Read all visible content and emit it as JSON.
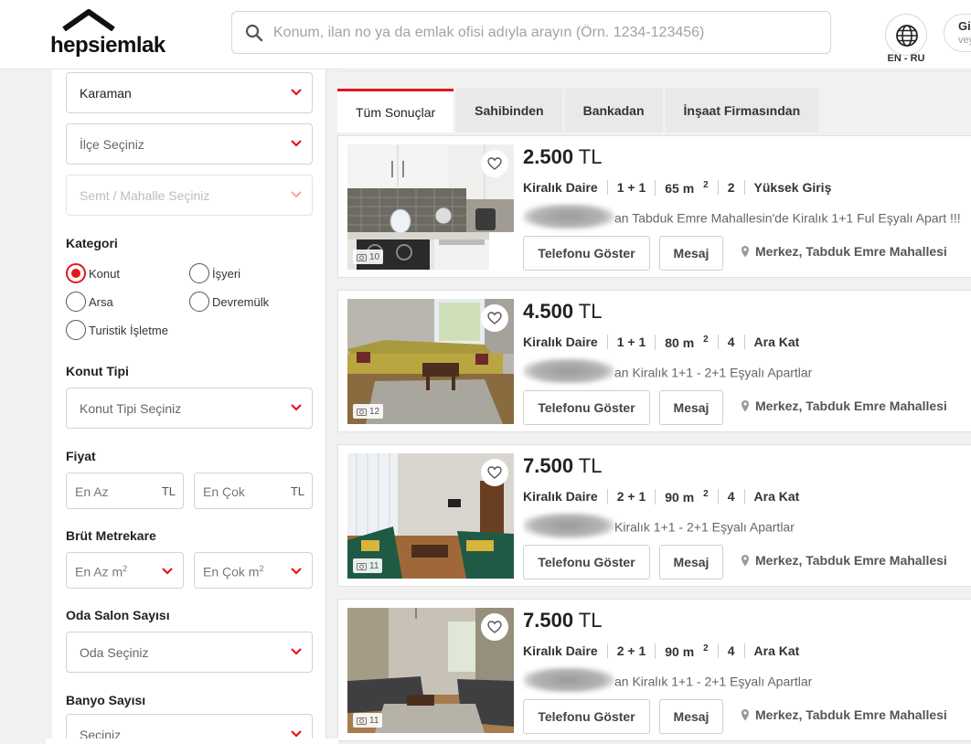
{
  "header": {
    "logo_text": "hepsiemlak",
    "search_placeholder": "Konum, ilan no ya da emlak ofisi adıyla arayın (Örn. 1234-123456)",
    "lang_label": "EN - RU",
    "login_line1": "Giriş",
    "login_line2": "veya"
  },
  "sidebar": {
    "city": "Karaman",
    "district": "İlçe Seçiniz",
    "neighborhood": "Semt / Mahalle Seçiniz",
    "category_title": "Kategori",
    "categories": [
      {
        "label": "Konut",
        "selected": true
      },
      {
        "label": "İşyeri",
        "selected": false
      },
      {
        "label": "Arsa",
        "selected": false
      },
      {
        "label": "Devremülk",
        "selected": false
      },
      {
        "label": "Turistik İşletme",
        "selected": false
      }
    ],
    "type_title": "Konut Tipi",
    "type_select": "Konut Tipi Seçiniz",
    "price_title": "Fiyat",
    "price_min": "En Az",
    "price_max": "En Çok",
    "price_unit": "TL",
    "area_title": "Brüt Metrekare",
    "area_min": "En Az m",
    "area_max": "En Çok m",
    "area_sup": "2",
    "rooms_title": "Oda Salon Sayısı",
    "rooms_select": "Oda Seçiniz",
    "bath_title": "Banyo Sayısı",
    "bath_select": "Seçiniz"
  },
  "tabs": [
    "Tüm Sonuçlar",
    "Sahibinden",
    "Bankadan",
    "İnşaat Firmasından"
  ],
  "listings": [
    {
      "price_num": "2.500",
      "currency": "TL",
      "type": "Kiralık Daire",
      "rooms": "1 + 1",
      "area": "65 m",
      "area_sup": "2",
      "floor_count": "2",
      "floor": "Yüksek Giriş",
      "title": "an Tabduk Emre Mahallesin'de Kiralık 1+1 Ful Eşyalı Apart !!!",
      "photo_count": "10",
      "location": "Merkez, Tabduk Emre Mahallesi"
    },
    {
      "price_num": "4.500",
      "currency": "TL",
      "type": "Kiralık Daire",
      "rooms": "1 + 1",
      "area": "80 m",
      "area_sup": "2",
      "floor_count": "4",
      "floor": "Ara Kat",
      "title": "an Kiralık 1+1 - 2+1 Eşyalı Apartlar",
      "photo_count": "12",
      "location": "Merkez, Tabduk Emre Mahallesi"
    },
    {
      "price_num": "7.500",
      "currency": "TL",
      "type": "Kiralık Daire",
      "rooms": "2 + 1",
      "area": "90 m",
      "area_sup": "2",
      "floor_count": "4",
      "floor": "Ara Kat",
      "title": "Kiralık 1+1 - 2+1 Eşyalı Apartlar",
      "photo_count": "11",
      "location": "Merkez, Tabduk Emre Mahallesi"
    },
    {
      "price_num": "7.500",
      "currency": "TL",
      "type": "Kiralık Daire",
      "rooms": "2 + 1",
      "area": "90 m",
      "area_sup": "2",
      "floor_count": "4",
      "floor": "Ara Kat",
      "title": "an Kiralık 1+1 - 2+1 Eşyalı Apartlar",
      "photo_count": "11",
      "location": "Merkez, Tabduk Emre Mahallesi"
    }
  ],
  "card_buttons": {
    "phone": "Telefonu Göster",
    "message": "Mesaj"
  },
  "colors": {
    "brand": "#e5151d"
  }
}
